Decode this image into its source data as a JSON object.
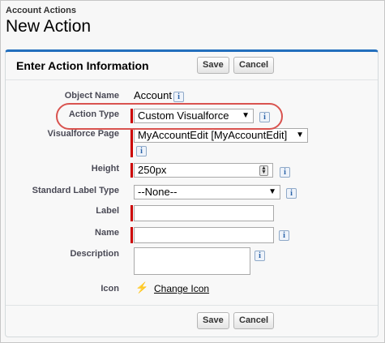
{
  "header": {
    "subtitle": "Account Actions",
    "title": "New Action"
  },
  "panel": {
    "title": "Enter Action Information"
  },
  "buttons": {
    "save_label": "Save",
    "cancel_label": "Cancel"
  },
  "fields": {
    "object_name": {
      "label": "Object Name",
      "value": "Account"
    },
    "action_type": {
      "label": "Action Type",
      "value": "Custom Visualforce"
    },
    "visualforce_page": {
      "label": "Visualforce Page",
      "value": "MyAccountEdit [MyAccountEdit]"
    },
    "height": {
      "label": "Height",
      "value": "250px"
    },
    "standard_label_type": {
      "label": "Standard Label Type",
      "value": "--None--"
    },
    "label": {
      "label": "Label",
      "value": ""
    },
    "name": {
      "label": "Name",
      "value": ""
    },
    "description": {
      "label": "Description",
      "value": ""
    },
    "icon": {
      "label": "Icon",
      "link": "Change Icon"
    }
  },
  "glyphs": {
    "info": "i",
    "dropdown": "▼",
    "bolt": "⚡"
  },
  "colors": {
    "accent": "#236fbd",
    "required": "#cc0000",
    "highlight": "#d9534f"
  }
}
